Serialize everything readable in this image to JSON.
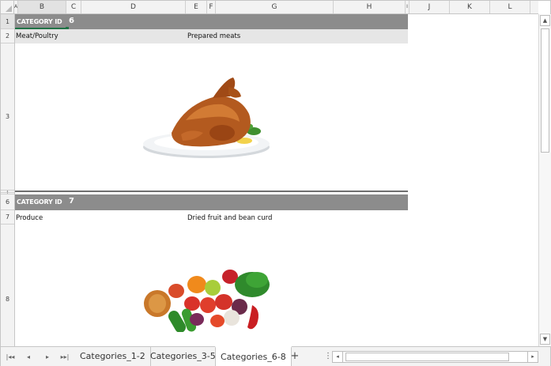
{
  "columns": [
    "A",
    "B",
    "C",
    "D",
    "E",
    "F",
    "G",
    "H",
    "I",
    "J",
    "K",
    "L"
  ],
  "rows": [
    "1",
    "2",
    "3",
    "4",
    "5",
    "6",
    "7",
    "8"
  ],
  "records": [
    {
      "band_label": "CATEGORY ID",
      "category_id": "6",
      "category_name": "Meat/Poultry",
      "description": "Prepared meats",
      "image": "roast-chicken-image"
    },
    {
      "band_label": "CATEGORY ID",
      "category_id": "7",
      "category_name": "Produce",
      "description": "Dried fruit and bean curd",
      "image": "vegetables-image"
    }
  ],
  "sheet_tabs": [
    {
      "label": "Categories_1-2",
      "active": false
    },
    {
      "label": "Categories_3-5",
      "active": false
    },
    {
      "label": "Categories_6-8",
      "active": true
    }
  ],
  "icons": {
    "first_sheet": "first-sheet-icon",
    "prev_sheet": "prev-sheet-icon",
    "next_sheet": "next-sheet-icon",
    "last_sheet": "last-sheet-icon",
    "add_sheet": "plus-icon",
    "options": "vertical-dots-icon",
    "scroll_up": "arrow-up-icon",
    "scroll_down": "arrow-down-icon",
    "scroll_left": "arrow-left-icon",
    "scroll_right": "arrow-right-icon"
  },
  "colors": {
    "band": "#8c8c8c",
    "selection": "#217346",
    "header_bg": "#f3f3f3"
  }
}
